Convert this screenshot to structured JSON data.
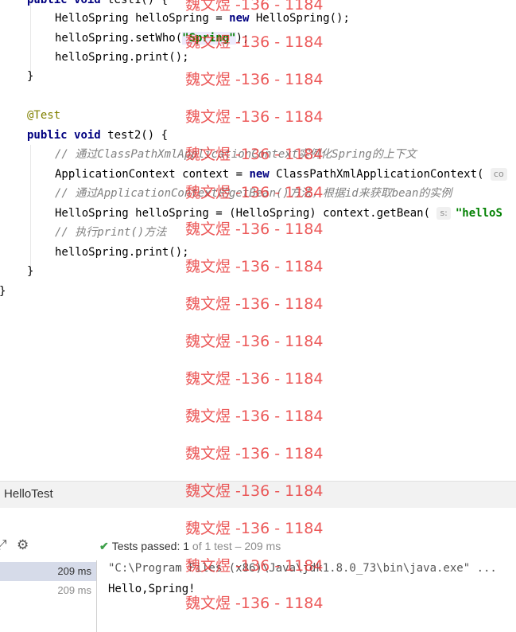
{
  "code": {
    "line_test1_sig": {
      "k1": "public",
      "k2": "void",
      "rest": " test1() {"
    },
    "line_new1": {
      "a": "HelloSpring helloSpring = ",
      "k": "new",
      "b": " HelloSpring();"
    },
    "line_setwho": {
      "a": "helloSpring.setWho(",
      "s": "\"Spring\"",
      "b": ");"
    },
    "line_print1": "helloSpring.print();",
    "close1": "}",
    "annotation": "@Test",
    "line_test2_sig": {
      "k1": "public",
      "k2": "void",
      "rest": " test2() {"
    },
    "comment1": "// 通过ClassPathXmlApplicationContext实例化Spring的上下文",
    "line_ctx": {
      "a": "ApplicationContext context = ",
      "k": "new",
      "b": " ClassPathXmlApplicationContext( ",
      "hint": "co"
    },
    "comment2": "// 通过ApplicationContext的getBean()方法，根据id来获取bean的实例",
    "line_getbean": {
      "a": "HelloSpring helloSpring = (HelloSpring) context.getBean( ",
      "hint": "s:",
      "s": "\"helloS"
    },
    "comment3": "// 执行print()方法",
    "line_print2": "helloSpring.print();",
    "close2": "}",
    "close_class": "}"
  },
  "run_panel": {
    "title": "HelloTest",
    "status_label": "Tests passed:",
    "passed": "1",
    "of_total": "of 1 test",
    "dash": "–",
    "duration": "209 ms",
    "tree": [
      {
        "time": "209 ms"
      },
      {
        "time": "209 ms"
      }
    ],
    "console": [
      "\"C:\\Program Files (x86)\\Java\\jdk1.8.0_73\\bin\\java.exe\" ...",
      "Hello,Spring!"
    ]
  },
  "watermark_text": "魏文煜 -136 - 1184",
  "icons": [
    "expand-icon",
    "gear-icon",
    "check-icon"
  ],
  "colors": {
    "keyword": "#000080",
    "string": "#008000",
    "annotation": "#808000",
    "comment": "#808080",
    "watermark": "#e83434",
    "pass": "#3ea04a"
  }
}
